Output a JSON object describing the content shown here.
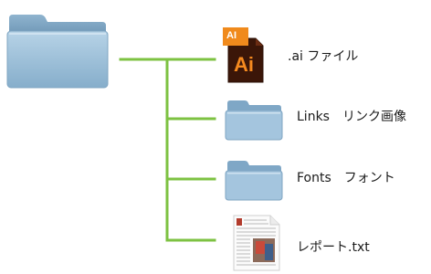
{
  "diagram": {
    "accent": "#7dc242",
    "root": {
      "icon": "folder-icon"
    },
    "items": [
      {
        "icon": "illustrator-file-icon",
        "badge": "AI",
        "logo": "Ai",
        "label": ".ai ファイル"
      },
      {
        "icon": "folder-icon",
        "label": "Links　リンク画像"
      },
      {
        "icon": "folder-icon",
        "label": "Fonts　フォント"
      },
      {
        "icon": "text-document-icon",
        "label": "レポート.txt"
      }
    ]
  }
}
